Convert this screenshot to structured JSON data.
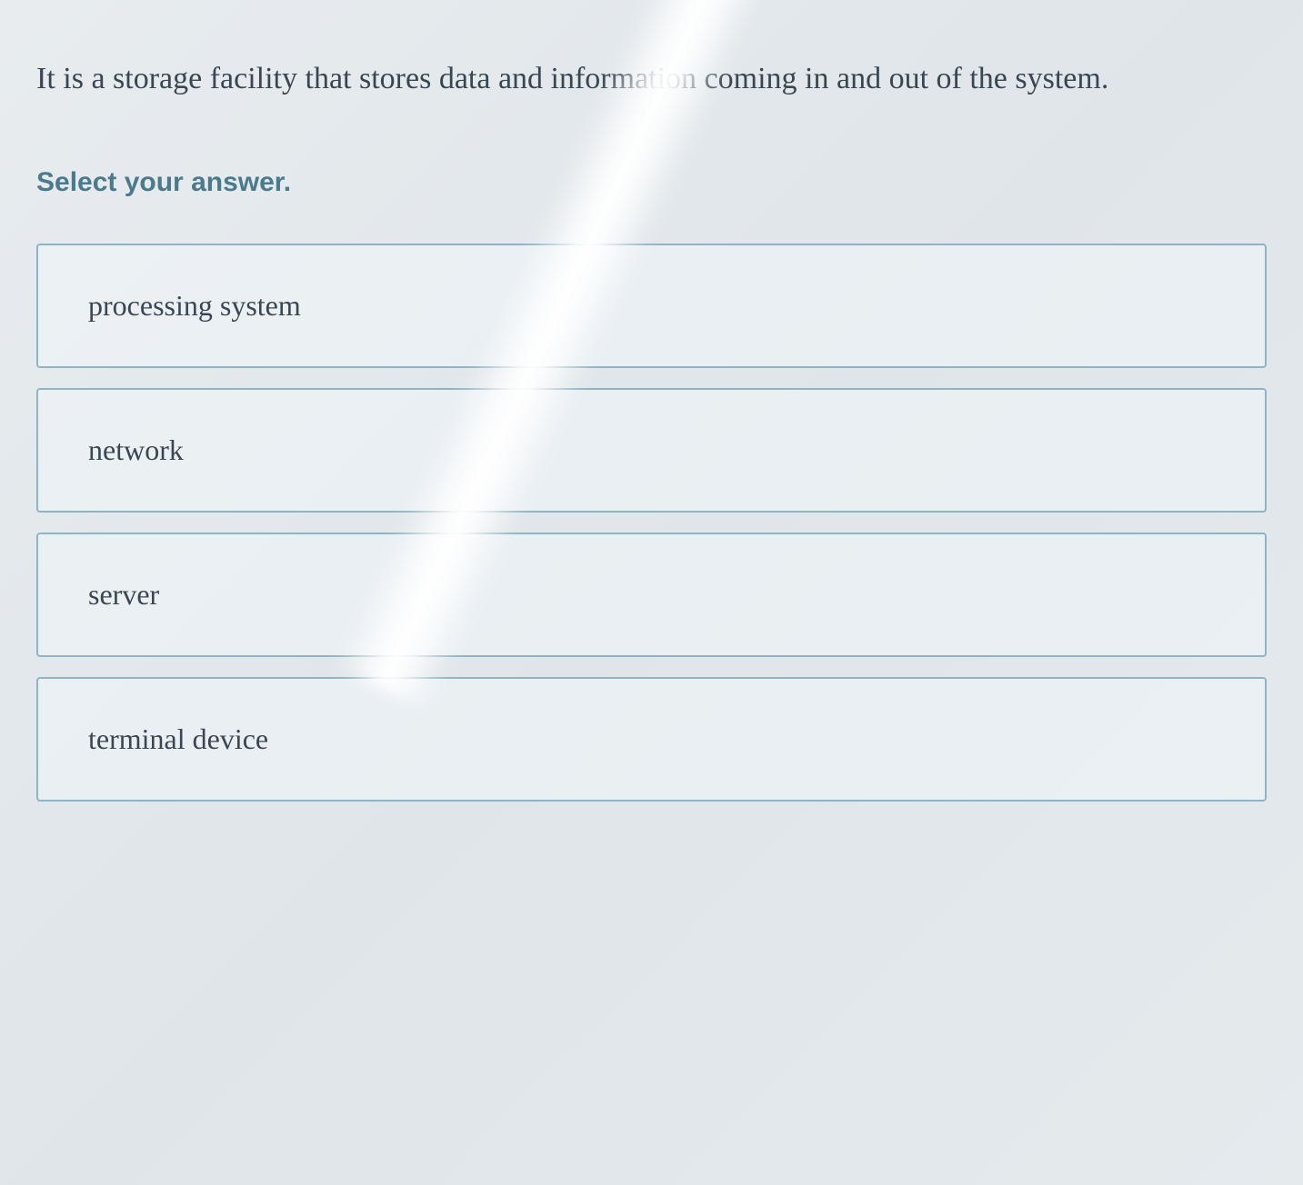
{
  "question": {
    "text": "It is a storage facility that stores data and information coming in and out of the system."
  },
  "instruction": "Select your answer.",
  "options": [
    {
      "label": "processing system"
    },
    {
      "label": "network"
    },
    {
      "label": "server"
    },
    {
      "label": "terminal device"
    }
  ]
}
